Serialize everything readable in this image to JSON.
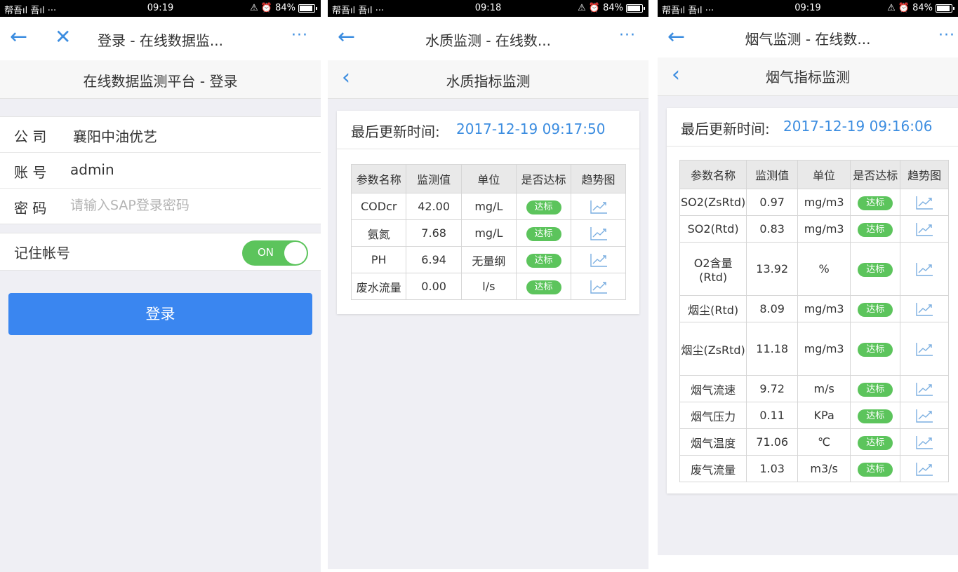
{
  "status": {
    "signal": "帮吾ıl 吾ıl ···",
    "battery": "84%",
    "times": [
      "09:19",
      "09:18",
      "09:19"
    ],
    "alarm_icons": "⚠ ⏰"
  },
  "login": {
    "nav_title": "登录 - 在线数据监...",
    "more": "···",
    "header": "在线数据监测平台 - 登录",
    "company_label": "公 司",
    "company_value": "襄阳中油优艺",
    "account_label": "账 号",
    "account_value": "admin",
    "password_label": "密 码",
    "password_placeholder": "请输入SAP登录密码",
    "remember_label": "记住帐号",
    "toggle_text": "ON",
    "login_button": "登录"
  },
  "water": {
    "nav_title": "水质监测 - 在线数...",
    "more": "···",
    "header": "水质指标监测",
    "update_label": "最后更新时间:",
    "update_value": "2017-12-19 09:17:50",
    "columns": [
      "参数名称",
      "监测值",
      "单位",
      "是否达标",
      "趋势图"
    ],
    "rows": [
      {
        "name": "CODcr",
        "value": "42.00",
        "unit": "mg/L",
        "status": "达标"
      },
      {
        "name": "氨氮",
        "value": "7.68",
        "unit": "mg/L",
        "status": "达标"
      },
      {
        "name": "PH",
        "value": "6.94",
        "unit": "无量纲",
        "status": "达标"
      },
      {
        "name": "废水流量",
        "value": "0.00",
        "unit": "l/s",
        "status": "达标"
      }
    ]
  },
  "smoke": {
    "nav_title": "烟气监测 - 在线数...",
    "more": "···",
    "header": "烟气指标监测",
    "update_label": "最后更新时间:",
    "update_value": "2017-12-19 09:16:06",
    "columns": [
      "参数名称",
      "监测值",
      "单位",
      "是否达标",
      "趋势图"
    ],
    "rows": [
      {
        "name": "SO2(ZsRtd)",
        "value": "0.97",
        "unit": "mg/m3",
        "status": "达标"
      },
      {
        "name": "SO2(Rtd)",
        "value": "0.83",
        "unit": "mg/m3",
        "status": "达标"
      },
      {
        "name": "O2含量(Rtd)",
        "value": "13.92",
        "unit": "%",
        "status": "达标"
      },
      {
        "name": "烟尘(Rtd)",
        "value": "8.09",
        "unit": "mg/m3",
        "status": "达标"
      },
      {
        "name": "烟尘(ZsRtd)",
        "value": "11.18",
        "unit": "mg/m3",
        "status": "达标"
      },
      {
        "name": "烟气流速",
        "value": "9.72",
        "unit": "m/s",
        "status": "达标"
      },
      {
        "name": "烟气压力",
        "value": "0.11",
        "unit": "KPa",
        "status": "达标"
      },
      {
        "name": "烟气温度",
        "value": "71.06",
        "unit": "℃",
        "status": "达标"
      },
      {
        "name": "废气流量",
        "value": "1.03",
        "unit": "m3/s",
        "status": "达标"
      }
    ]
  }
}
